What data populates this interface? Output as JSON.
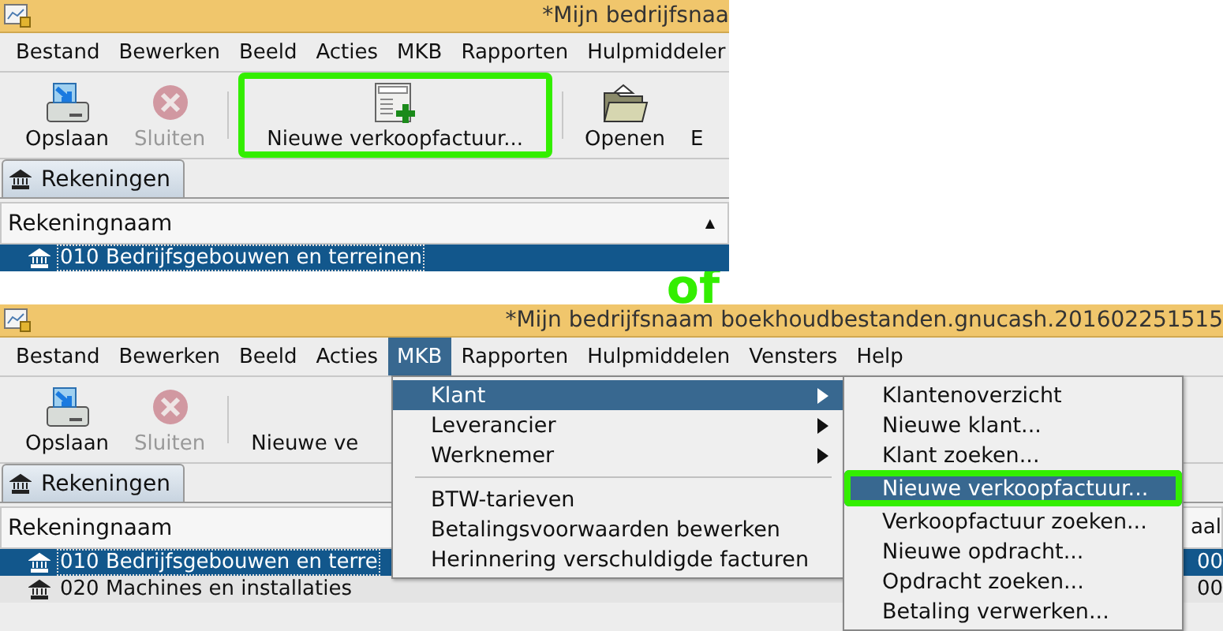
{
  "panels": [
    {
      "title": "*Mijn bedrijfsnaa",
      "menu": [
        {
          "label": "Bestand",
          "selected": false
        },
        {
          "label": "Bewerken",
          "selected": false
        },
        {
          "label": "Beeld",
          "selected": false
        },
        {
          "label": "Acties",
          "selected": false
        },
        {
          "label": "MKB",
          "selected": false
        },
        {
          "label": "Rapporten",
          "selected": false
        },
        {
          "label": "Hulpmiddeler",
          "selected": false
        }
      ],
      "toolbar": [
        {
          "kind": "save",
          "label": "Opslaan",
          "disabled": false,
          "highlighted": false
        },
        {
          "kind": "close",
          "label": "Sluiten",
          "disabled": true,
          "highlighted": false
        },
        {
          "kind": "separator"
        },
        {
          "kind": "invoice",
          "label": "Nieuwe verkoopfactuur...",
          "disabled": false,
          "highlighted": true
        },
        {
          "kind": "separator"
        },
        {
          "kind": "folder",
          "label": "Openen",
          "disabled": false,
          "highlighted": false
        },
        {
          "kind": "text",
          "label": "E",
          "disabled": false,
          "highlighted": false
        }
      ],
      "tabs": [
        {
          "label": "Rekeningen",
          "selected": true
        }
      ],
      "header": {
        "label": "Rekeningnaam",
        "sort": "▲"
      },
      "rows": [
        {
          "name": "010 Bedrijfsgebouwen en terreinen",
          "selected": true
        }
      ]
    },
    {
      "title": "*Mijn bedrijfsnaam boekhoudbestanden.gnucash.201602251515",
      "menu": [
        {
          "label": "Bestand",
          "selected": false
        },
        {
          "label": "Bewerken",
          "selected": false
        },
        {
          "label": "Beeld",
          "selected": false
        },
        {
          "label": "Acties",
          "selected": false
        },
        {
          "label": "MKB",
          "selected": true
        },
        {
          "label": "Rapporten",
          "selected": false
        },
        {
          "label": "Hulpmiddelen",
          "selected": false
        },
        {
          "label": "Vensters",
          "selected": false
        },
        {
          "label": "Help",
          "selected": false
        }
      ],
      "toolbar": [
        {
          "kind": "save",
          "label": "Opslaan",
          "disabled": false,
          "highlighted": false
        },
        {
          "kind": "close",
          "label": "Sluiten",
          "disabled": true,
          "highlighted": false
        },
        {
          "kind": "separator"
        },
        {
          "kind": "text",
          "label": "Nieuwe ve",
          "disabled": false,
          "highlighted": false
        }
      ],
      "tabs": [
        {
          "label": "Rekeningen",
          "selected": true
        }
      ],
      "header": {
        "label": "Rekeningnaam",
        "column_2": "aal"
      },
      "rows": [
        {
          "name": "010 Bedrijfsgebouwen en terre",
          "selected": true,
          "column_2": "00"
        },
        {
          "name": "020 Machines en installaties",
          "selected": false,
          "column_2": "00"
        }
      ],
      "dropdown": {
        "items": [
          {
            "kind": "item",
            "label": "Klant",
            "selected": true,
            "submenu": true
          },
          {
            "kind": "item",
            "label": "Leverancier",
            "selected": false,
            "submenu": true
          },
          {
            "kind": "item",
            "label": "Werknemer",
            "selected": false,
            "submenu": true
          },
          {
            "kind": "separator"
          },
          {
            "kind": "item",
            "label": "BTW-tarieven",
            "selected": false,
            "submenu": false
          },
          {
            "kind": "item",
            "label": "Betalingsvoorwaarden bewerken",
            "selected": false,
            "submenu": false
          },
          {
            "kind": "item",
            "label": "Herinnering verschuldigde facturen",
            "selected": false,
            "submenu": false
          }
        ]
      },
      "submenu": {
        "items": [
          {
            "label": "Klantenoverzicht",
            "selected": false,
            "highlighted": false
          },
          {
            "label": "Nieuwe klant...",
            "selected": false,
            "highlighted": false
          },
          {
            "label": "Klant zoeken...",
            "selected": false,
            "highlighted": false
          },
          {
            "label": "Nieuwe verkoopfactuur...",
            "selected": true,
            "highlighted": true
          },
          {
            "label": "Verkoopfactuur zoeken...",
            "selected": false,
            "highlighted": false
          },
          {
            "label": "Nieuwe opdracht...",
            "selected": false,
            "highlighted": false
          },
          {
            "label": "Opdracht zoeken...",
            "selected": false,
            "highlighted": false
          },
          {
            "label": "Betaling verwerken...",
            "selected": false,
            "highlighted": false
          }
        ]
      }
    }
  ],
  "separator_text": "of"
}
